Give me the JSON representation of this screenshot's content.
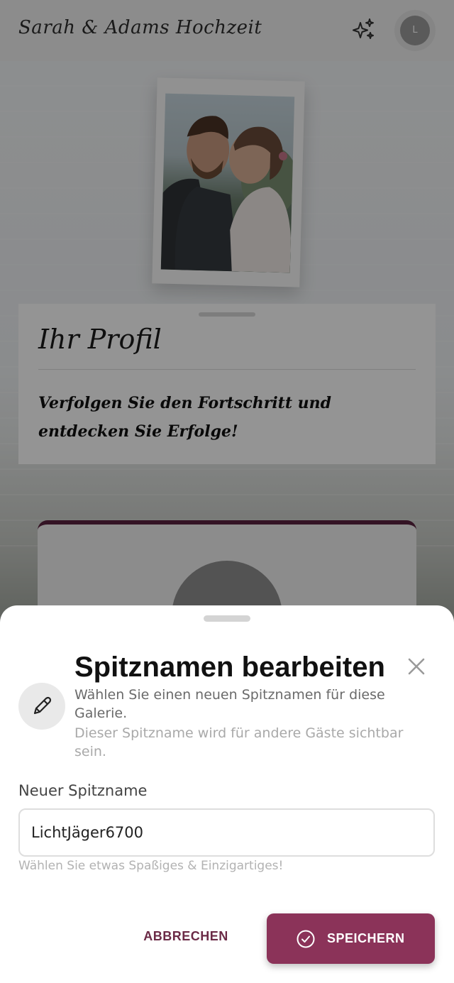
{
  "header": {
    "title": "Sarah & Adams Hochzeit",
    "avatar_initial": "L"
  },
  "profile_card": {
    "title": "Ihr Profil",
    "subtitle": "Verfolgen Sie den Fortschritt und entdecken Sie Erfolge!"
  },
  "sheet": {
    "title": "Spitznamen bearbeiten",
    "description": "Wählen Sie einen neuen Spitznamen für diese Galerie.",
    "note": "Dieser Spitzname wird für andere Gäste sichtbar sein.",
    "field_label": "Neuer Spitzname",
    "field_value": "LichtJäger6700",
    "hint": "Wählen Sie etwas Spaßiges & Einzigartiges!",
    "cancel_label": "ABBRECHEN",
    "save_label": "SPEICHERN"
  },
  "icons": {
    "sparkle": "sparkle-icon",
    "close": "close-icon",
    "pencil": "pencil-icon",
    "check": "check-circle-icon"
  },
  "colors": {
    "accent": "#8b3359",
    "accent_dark": "#6b2a46"
  }
}
